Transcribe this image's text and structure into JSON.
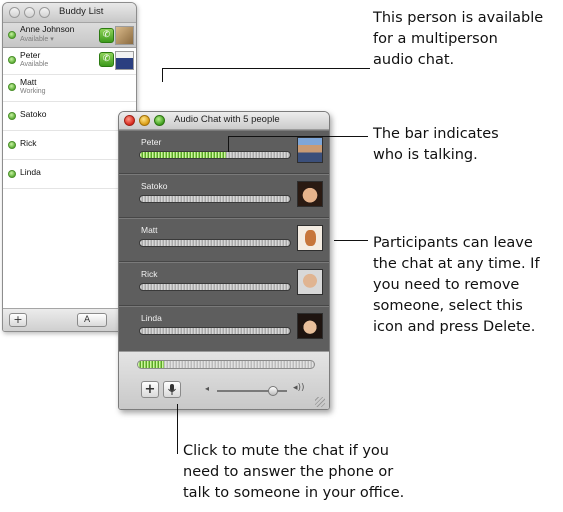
{
  "buddy_list": {
    "title": "Buddy List",
    "me": {
      "name": "Anne Johnson",
      "status": "Available ▾"
    },
    "buddies": [
      {
        "name": "Peter",
        "status": "Available"
      },
      {
        "name": "Matt",
        "status": "Working"
      },
      {
        "name": "Satoko",
        "status": ""
      },
      {
        "name": "Rick",
        "status": ""
      },
      {
        "name": "Linda",
        "status": ""
      }
    ],
    "footer": {
      "add_label": "+",
      "font_label": "A"
    }
  },
  "audio_chat": {
    "title": "Audio Chat with 5 people",
    "participants": [
      {
        "name": "Peter",
        "level": 0.57
      },
      {
        "name": "Satoko",
        "level": 0
      },
      {
        "name": "Matt",
        "level": 0
      },
      {
        "name": "Rick",
        "level": 0
      },
      {
        "name": "Linda",
        "level": 0
      }
    ],
    "input_level": 0.15,
    "add_label": "+",
    "volume_level": 0.8
  },
  "callouts": {
    "multiperson": [
      "This person is available",
      "for a multiperson",
      "audio chat."
    ],
    "talking": [
      "The bar indicates",
      "who is talking."
    ],
    "leave": [
      "Participants can leave",
      "the chat at any time. If",
      "you need to remove",
      "someone, select this",
      "icon and press Delete."
    ],
    "mute": [
      "Click to mute the chat if you",
      "need to answer the phone or",
      "talk to someone in your office."
    ]
  },
  "colors": {
    "accent_green": "#5aa826",
    "panel_gray": "#5e5e5e"
  }
}
